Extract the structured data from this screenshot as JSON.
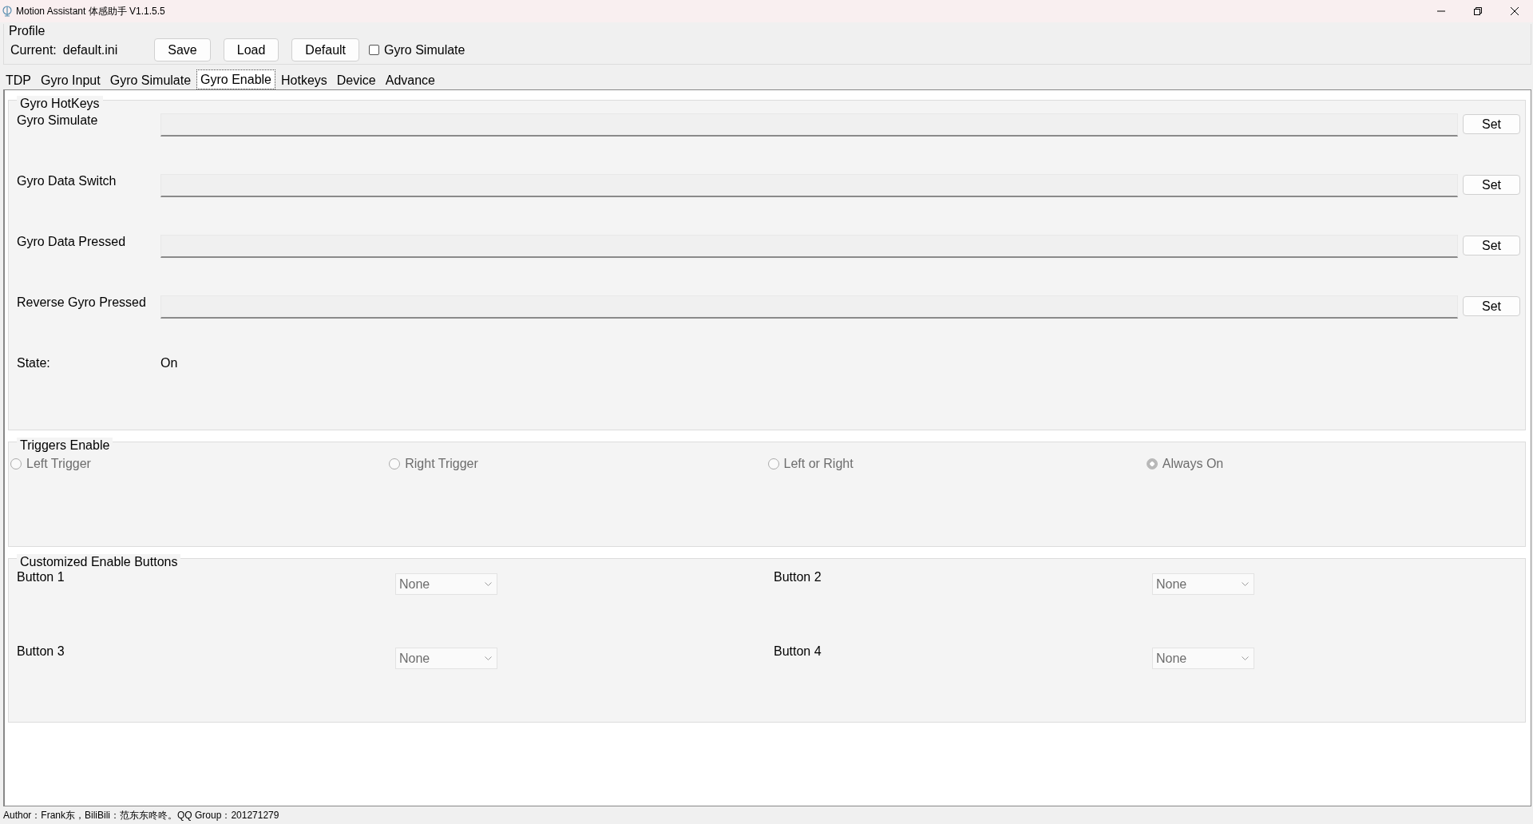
{
  "window": {
    "title": "Motion Assistant 体感助手 V1.1.5.5"
  },
  "profile": {
    "title": "Profile",
    "current_label": "Current:",
    "current_value": "default.ini",
    "buttons": [
      "Save",
      "Load",
      "Default"
    ],
    "gyro_simulate": {
      "label": "Gyro Simulate",
      "checked": false
    }
  },
  "tabs": [
    {
      "label": "TDP",
      "selected": false
    },
    {
      "label": "Gyro Input",
      "selected": false
    },
    {
      "label": "Gyro Simulate",
      "selected": false
    },
    {
      "label": "Gyro Enable",
      "selected": true
    },
    {
      "label": "Hotkeys",
      "selected": false
    },
    {
      "label": "Device",
      "selected": false
    },
    {
      "label": "Advance",
      "selected": false
    }
  ],
  "gyro_hotkeys": {
    "title": "Gyro HotKeys",
    "rows": [
      {
        "label": "Gyro Simulate",
        "button": "Set"
      },
      {
        "label": "Gyro Data Switch",
        "button": "Set"
      },
      {
        "label": "Gyro Data Pressed",
        "button": "Set"
      },
      {
        "label": "Reverse Gyro Pressed",
        "button": "Set"
      }
    ],
    "state_label": "State:",
    "state_value": "On"
  },
  "triggers_enable": {
    "title": "Triggers Enable",
    "options": [
      {
        "label": "Left Trigger",
        "selected": false,
        "disabled": true
      },
      {
        "label": "Right Trigger",
        "selected": false,
        "disabled": true
      },
      {
        "label": "Left or Right",
        "selected": false,
        "disabled": true
      },
      {
        "label": "Always On",
        "selected": true,
        "disabled": true
      }
    ]
  },
  "customized_enable_buttons": {
    "title": "Customized Enable Buttons",
    "items": [
      {
        "label": "Button 1",
        "value": "None",
        "disabled": true
      },
      {
        "label": "Button 2",
        "value": "None",
        "disabled": true
      },
      {
        "label": "Button 3",
        "value": "None",
        "disabled": true
      },
      {
        "label": "Button 4",
        "value": "None",
        "disabled": true
      }
    ]
  },
  "status_bar": "Author：Frank东，BiliBili：范东东咚咚。QQ Group：201271279"
}
